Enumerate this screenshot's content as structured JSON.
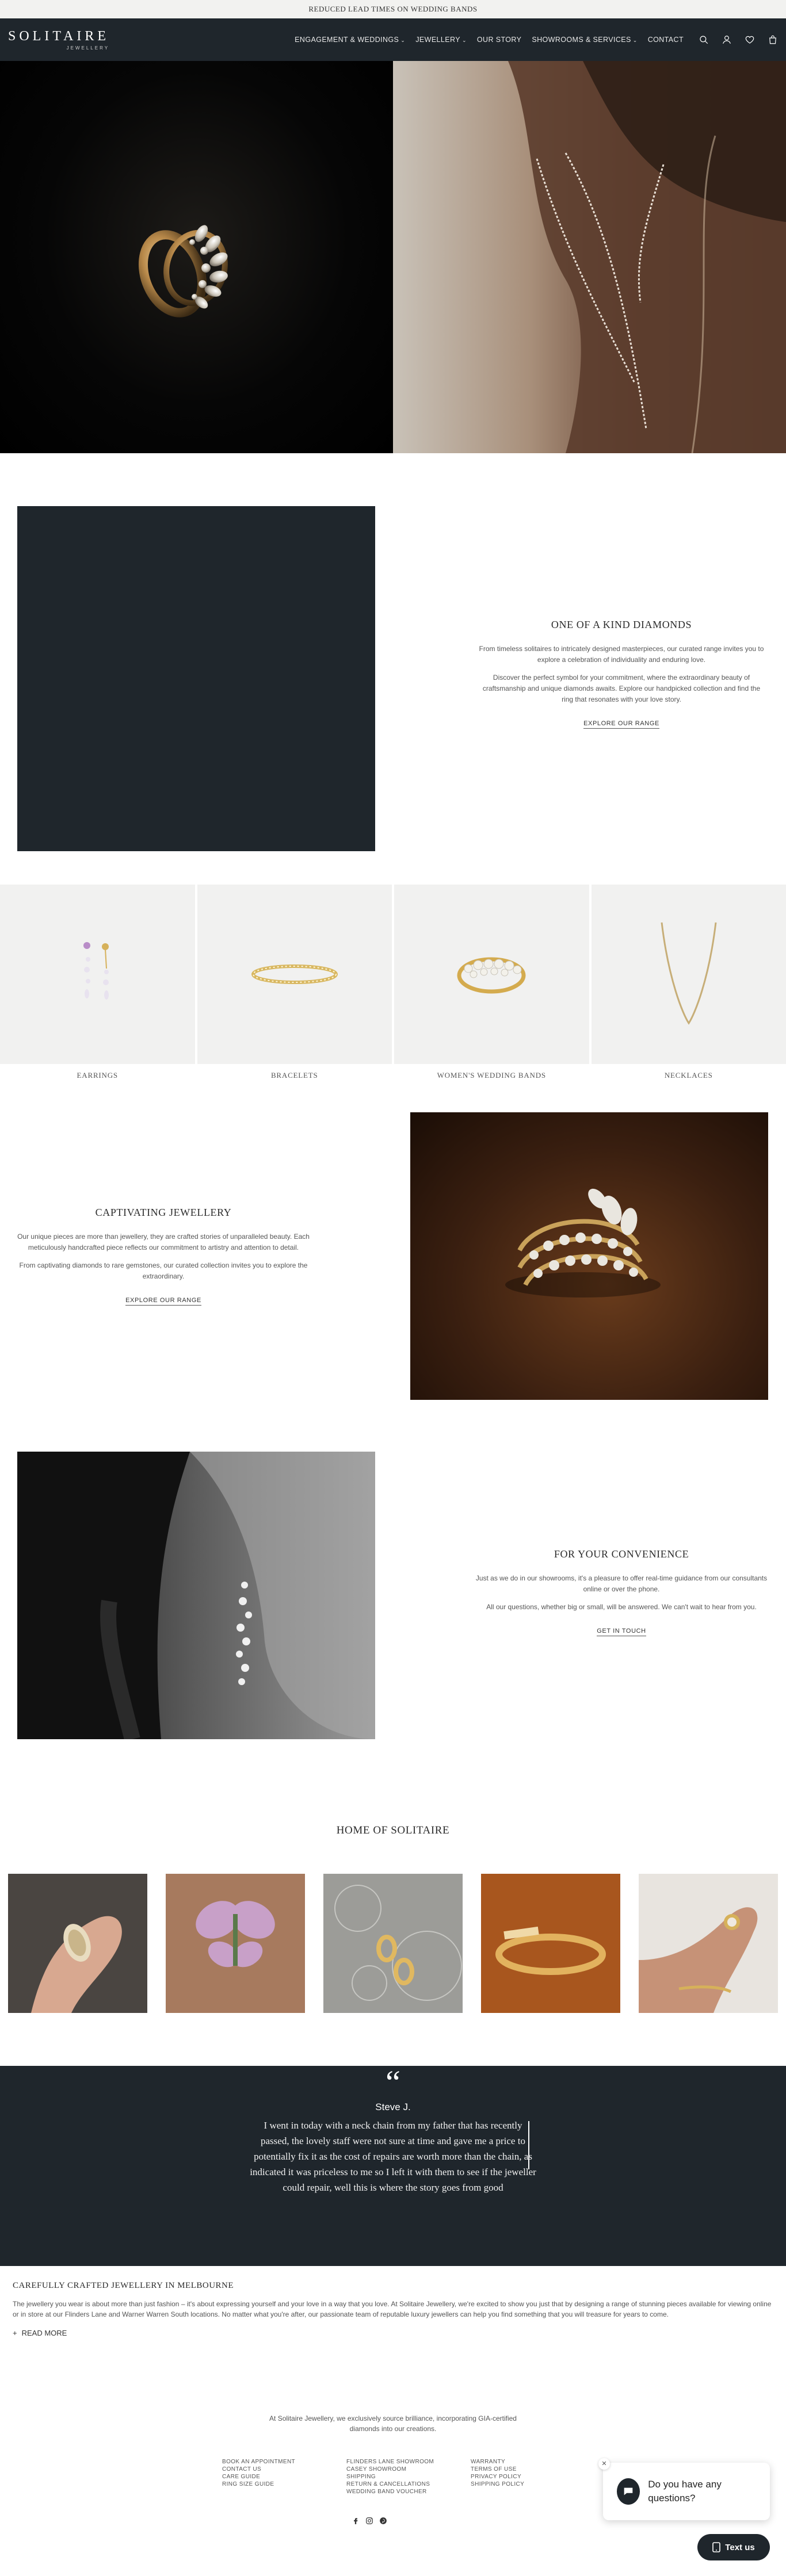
{
  "announcement": "Reduced lead times on Wedding Bands",
  "header": {
    "brand": "SOLITAIRE",
    "brand_sub": "JEWELLERY",
    "nav": [
      "Engagement & Weddings",
      "Jewellery",
      "Our Story",
      "Showrooms & Services",
      "Contact"
    ],
    "nav_has_dropdown": [
      true,
      true,
      false,
      true,
      false
    ],
    "icons": [
      "search-icon",
      "account-icon",
      "heart-icon",
      "bag-icon"
    ]
  },
  "diamonds": {
    "title": "One of a Kind Diamonds",
    "p1": "From timeless solitaires to intricately designed masterpieces, our curated range invites you to explore a celebration of individuality and enduring love.",
    "p2": "Discover the perfect symbol for your commitment, where the extraordinary beauty of craftsmanship and unique diamonds awaits. Explore our handpicked collection and find the ring that resonates with your love story.",
    "link": "Explore our range"
  },
  "categories": [
    {
      "label": "Earrings"
    },
    {
      "label": "Bracelets"
    },
    {
      "label": "Women's Wedding Bands"
    },
    {
      "label": "Necklaces"
    }
  ],
  "captivating": {
    "title": "Captivating Jewellery",
    "p1": "Our unique pieces are more than jewellery, they are crafted stories of unparalleled beauty. Each meticulously handcrafted piece reflects our commitment to artistry and attention to detail.",
    "p2": "From captivating diamonds to rare gemstones, our curated collection invites you to explore the extraordinary.",
    "link": "Explore our range"
  },
  "convenience": {
    "title": "For Your Convenience",
    "p1": "Just as we do in our showrooms, it's a pleasure to offer real-time guidance from our consultants online or over the phone.",
    "p2": "All our questions, whether big or small, will be answered. We can't wait to hear from you.",
    "link": "Get in touch"
  },
  "home": {
    "title": "Home of Solitaire"
  },
  "testimonial": {
    "quote_mark": "“",
    "name": "Steve J.",
    "text": "I went in today with a neck chain from my father that has recently passed, the lovely staff were not sure at time and gave me a price to potentially fix it as the cost of repairs are worth more than the chain, as indicated it was priceless to me so I left it with them to see if the jeweller could repair, well this is where the story goes from good"
  },
  "about": {
    "title": "Carefully crafted jewellery in Melbourne",
    "text": "The jewellery you wear is about more than just fashion – it's about expressing yourself and your love in a way that you love. At Solitaire Jewellery, we're excited to show you just that by designing a range of stunning pieces available for viewing online or in store at our Flinders Lane and Warner Warren South locations. No matter what you're after, our passionate team of reputable luxury jewellers can help you find something that you will treasure for years to come.",
    "read_more": "Read more"
  },
  "footer": {
    "blurb1": "At Solitaire Jewellery, we exclusively source brilliance, incorporating GIA-certified",
    "blurb2": "diamonds into our creations.",
    "col1": [
      "Book an Appointment",
      "Contact Us",
      "Care Guide",
      "Ring Size Guide"
    ],
    "col2": [
      "Flinders Lane Showroom",
      "Casey Showroom",
      "Shipping",
      "Return & Cancellations",
      "Wedding Band Voucher"
    ],
    "col3": [
      "Warranty",
      "Terms of Use",
      "Privacy Policy",
      "Shipping Policy"
    ],
    "social": [
      "facebook-icon",
      "instagram-icon",
      "pinterest-icon"
    ]
  },
  "chat": {
    "message": "Do you have any questions?",
    "button": "Text us"
  }
}
